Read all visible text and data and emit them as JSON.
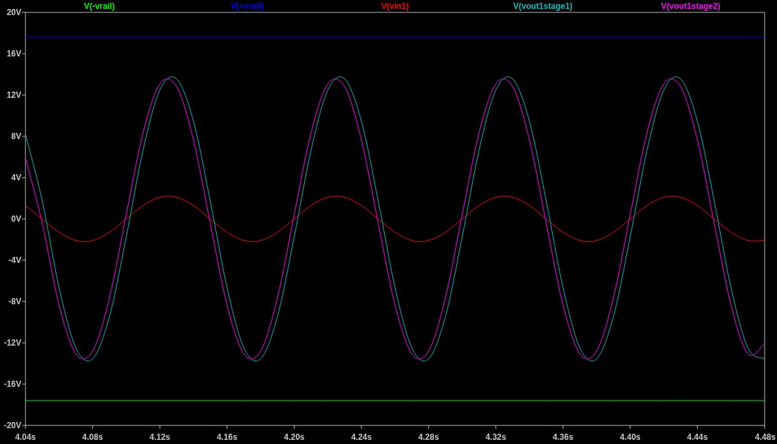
{
  "plot": {
    "chart_data": {
      "type": "line",
      "xlim": [
        4.04,
        4.48
      ],
      "ylim": [
        -20,
        20
      ],
      "x": [
        4.04,
        4.05,
        4.06,
        4.07,
        4.08,
        4.09,
        4.1,
        4.11,
        4.12,
        4.13,
        4.14,
        4.15,
        4.16,
        4.17,
        4.18,
        4.19,
        4.2,
        4.21,
        4.22,
        4.23,
        4.24,
        4.25,
        4.26,
        4.27,
        4.28,
        4.29,
        4.3,
        4.31,
        4.32,
        4.33,
        4.34,
        4.35,
        4.36,
        4.37,
        4.38,
        4.39,
        4.4,
        4.41,
        4.42,
        4.43,
        4.44,
        4.45,
        4.46,
        4.47,
        4.48
      ],
      "series": [
        {
          "name": "V(-vrail)",
          "color": "#00ff00",
          "values": [
            -17.6,
            -17.6,
            -17.6,
            -17.6,
            -17.6,
            -17.6,
            -17.6,
            -17.6,
            -17.6,
            -17.6,
            -17.6,
            -17.6,
            -17.6,
            -17.6,
            -17.6,
            -17.6,
            -17.6,
            -17.6,
            -17.6,
            -17.6,
            -17.6,
            -17.6,
            -17.6,
            -17.6,
            -17.6,
            -17.6,
            -17.6,
            -17.6,
            -17.6,
            -17.6,
            -17.6,
            -17.6,
            -17.6,
            -17.6,
            -17.6,
            -17.6,
            -17.6,
            -17.6,
            -17.6,
            -17.6,
            -17.6,
            -17.6,
            -17.6,
            -17.6,
            -17.6
          ]
        },
        {
          "name": "V(+vrail)",
          "color": "#0000ff",
          "values": [
            17.6,
            17.6,
            17.6,
            17.6,
            17.6,
            17.6,
            17.6,
            17.6,
            17.6,
            17.6,
            17.6,
            17.6,
            17.6,
            17.6,
            17.6,
            17.6,
            17.6,
            17.6,
            17.6,
            17.6,
            17.6,
            17.6,
            17.6,
            17.6,
            17.6,
            17.6,
            17.6,
            17.6,
            17.6,
            17.6,
            17.6,
            17.6,
            17.6,
            17.6,
            17.6,
            17.6,
            17.6,
            17.6,
            17.6,
            17.6,
            17.6,
            17.6,
            17.6,
            17.6,
            17.6
          ]
        },
        {
          "name": "V(vin1)",
          "color": "#ff0000",
          "values": [
            1.29,
            0,
            -1.29,
            -2.09,
            -2.09,
            -1.29,
            0,
            1.29,
            2.09,
            2.09,
            1.29,
            0,
            -1.29,
            -2.09,
            -2.09,
            -1.29,
            0,
            1.29,
            2.09,
            2.09,
            1.29,
            0,
            -1.29,
            -2.09,
            -2.09,
            -1.29,
            0,
            1.29,
            2.09,
            2.09,
            1.29,
            0,
            -1.29,
            -2.09,
            -2.09,
            -1.29,
            0,
            1.29,
            2.09,
            2.09,
            1.29,
            0,
            -1.29,
            -2.09,
            -2.09
          ]
        },
        {
          "name": "V(vout1stage1)",
          "color": "#00c0c0",
          "values": [
            8.2,
            1.73,
            -6.65,
            -12.49,
            -13.55,
            -9.45,
            -1.73,
            6.65,
            12.49,
            13.55,
            9.45,
            1.73,
            -6.65,
            -12.49,
            -13.55,
            -9.45,
            -1.73,
            6.65,
            12.49,
            13.55,
            9.45,
            1.73,
            -6.65,
            -12.49,
            -13.55,
            -9.45,
            -1.73,
            6.65,
            12.49,
            13.55,
            9.45,
            1.73,
            -6.65,
            -12.49,
            -13.55,
            -9.45,
            -1.73,
            6.65,
            12.49,
            13.55,
            9.45,
            1.73,
            -6.65,
            -12.49,
            -13.55
          ]
        },
        {
          "name": "V(vout1stage2)",
          "color": "#ff00ff",
          "values": [
            5.9,
            -0.43,
            -8.34,
            -13.06,
            -12.8,
            -7.64,
            0.43,
            8.34,
            13.06,
            12.8,
            7.64,
            -0.43,
            -8.34,
            -13.06,
            -12.8,
            -7.64,
            0.43,
            8.34,
            13.06,
            12.8,
            7.64,
            -0.43,
            -8.34,
            -13.06,
            -12.8,
            -7.64,
            0.43,
            8.34,
            13.06,
            12.8,
            7.64,
            -0.43,
            -8.34,
            -13.06,
            -12.8,
            -7.64,
            0.43,
            8.34,
            13.06,
            12.8,
            7.64,
            -0.43,
            -8.34,
            -13.06,
            -12.1
          ]
        }
      ],
      "xticks": [
        {
          "value": 4.04,
          "label": "4.04s"
        },
        {
          "value": 4.08,
          "label": "4.08s"
        },
        {
          "value": 4.12,
          "label": "4.12s"
        },
        {
          "value": 4.16,
          "label": "4.16s"
        },
        {
          "value": 4.2,
          "label": "4.20s"
        },
        {
          "value": 4.24,
          "label": "4.24s"
        },
        {
          "value": 4.28,
          "label": "4.28s"
        },
        {
          "value": 4.32,
          "label": "4.32s"
        },
        {
          "value": 4.36,
          "label": "4.36s"
        },
        {
          "value": 4.4,
          "label": "4.40s"
        },
        {
          "value": 4.44,
          "label": "4.44s"
        },
        {
          "value": 4.48,
          "label": "4.48s"
        }
      ],
      "yticks": [
        {
          "value": 20,
          "label": "20V"
        },
        {
          "value": 16,
          "label": "16V"
        },
        {
          "value": 12,
          "label": "12V"
        },
        {
          "value": 8,
          "label": "8V"
        },
        {
          "value": 4,
          "label": "4V"
        },
        {
          "value": 0,
          "label": "0V"
        },
        {
          "value": -4,
          "label": "-4V"
        },
        {
          "value": -8,
          "label": "-8V"
        },
        {
          "value": -12,
          "label": "-12V"
        },
        {
          "value": -16,
          "label": "-16V"
        },
        {
          "value": -20,
          "label": "-20V"
        }
      ]
    }
  }
}
